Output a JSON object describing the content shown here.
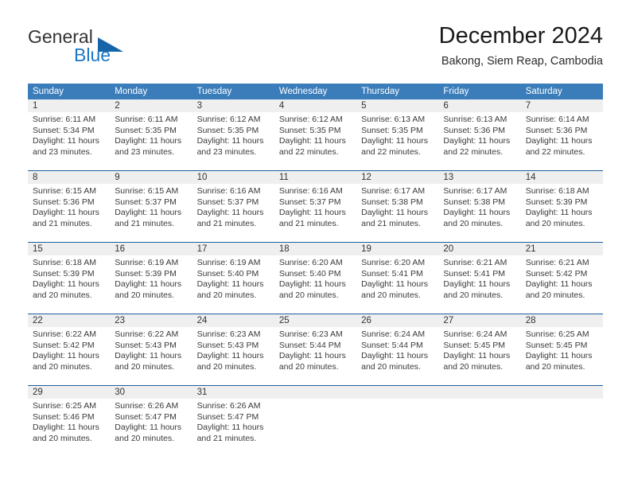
{
  "brand": {
    "line1": "General",
    "line2": "Blue",
    "icon": "triangle-logo",
    "accent_color": "#1d77c4"
  },
  "header": {
    "month_title": "December 2024",
    "location": "Bakong, Siem Reap, Cambodia"
  },
  "calendar": {
    "header_bg": "#3a7dba",
    "weekdays": [
      "Sunday",
      "Monday",
      "Tuesday",
      "Wednesday",
      "Thursday",
      "Friday",
      "Saturday"
    ],
    "weeks": [
      [
        {
          "day": "1",
          "sunrise": "Sunrise: 6:11 AM",
          "sunset": "Sunset: 5:34 PM",
          "daylight_1": "Daylight: 11 hours",
          "daylight_2": "and 23 minutes."
        },
        {
          "day": "2",
          "sunrise": "Sunrise: 6:11 AM",
          "sunset": "Sunset: 5:35 PM",
          "daylight_1": "Daylight: 11 hours",
          "daylight_2": "and 23 minutes."
        },
        {
          "day": "3",
          "sunrise": "Sunrise: 6:12 AM",
          "sunset": "Sunset: 5:35 PM",
          "daylight_1": "Daylight: 11 hours",
          "daylight_2": "and 23 minutes."
        },
        {
          "day": "4",
          "sunrise": "Sunrise: 6:12 AM",
          "sunset": "Sunset: 5:35 PM",
          "daylight_1": "Daylight: 11 hours",
          "daylight_2": "and 22 minutes."
        },
        {
          "day": "5",
          "sunrise": "Sunrise: 6:13 AM",
          "sunset": "Sunset: 5:35 PM",
          "daylight_1": "Daylight: 11 hours",
          "daylight_2": "and 22 minutes."
        },
        {
          "day": "6",
          "sunrise": "Sunrise: 6:13 AM",
          "sunset": "Sunset: 5:36 PM",
          "daylight_1": "Daylight: 11 hours",
          "daylight_2": "and 22 minutes."
        },
        {
          "day": "7",
          "sunrise": "Sunrise: 6:14 AM",
          "sunset": "Sunset: 5:36 PM",
          "daylight_1": "Daylight: 11 hours",
          "daylight_2": "and 22 minutes."
        }
      ],
      [
        {
          "day": "8",
          "sunrise": "Sunrise: 6:15 AM",
          "sunset": "Sunset: 5:36 PM",
          "daylight_1": "Daylight: 11 hours",
          "daylight_2": "and 21 minutes."
        },
        {
          "day": "9",
          "sunrise": "Sunrise: 6:15 AM",
          "sunset": "Sunset: 5:37 PM",
          "daylight_1": "Daylight: 11 hours",
          "daylight_2": "and 21 minutes."
        },
        {
          "day": "10",
          "sunrise": "Sunrise: 6:16 AM",
          "sunset": "Sunset: 5:37 PM",
          "daylight_1": "Daylight: 11 hours",
          "daylight_2": "and 21 minutes."
        },
        {
          "day": "11",
          "sunrise": "Sunrise: 6:16 AM",
          "sunset": "Sunset: 5:37 PM",
          "daylight_1": "Daylight: 11 hours",
          "daylight_2": "and 21 minutes."
        },
        {
          "day": "12",
          "sunrise": "Sunrise: 6:17 AM",
          "sunset": "Sunset: 5:38 PM",
          "daylight_1": "Daylight: 11 hours",
          "daylight_2": "and 21 minutes."
        },
        {
          "day": "13",
          "sunrise": "Sunrise: 6:17 AM",
          "sunset": "Sunset: 5:38 PM",
          "daylight_1": "Daylight: 11 hours",
          "daylight_2": "and 20 minutes."
        },
        {
          "day": "14",
          "sunrise": "Sunrise: 6:18 AM",
          "sunset": "Sunset: 5:39 PM",
          "daylight_1": "Daylight: 11 hours",
          "daylight_2": "and 20 minutes."
        }
      ],
      [
        {
          "day": "15",
          "sunrise": "Sunrise: 6:18 AM",
          "sunset": "Sunset: 5:39 PM",
          "daylight_1": "Daylight: 11 hours",
          "daylight_2": "and 20 minutes."
        },
        {
          "day": "16",
          "sunrise": "Sunrise: 6:19 AM",
          "sunset": "Sunset: 5:39 PM",
          "daylight_1": "Daylight: 11 hours",
          "daylight_2": "and 20 minutes."
        },
        {
          "day": "17",
          "sunrise": "Sunrise: 6:19 AM",
          "sunset": "Sunset: 5:40 PM",
          "daylight_1": "Daylight: 11 hours",
          "daylight_2": "and 20 minutes."
        },
        {
          "day": "18",
          "sunrise": "Sunrise: 6:20 AM",
          "sunset": "Sunset: 5:40 PM",
          "daylight_1": "Daylight: 11 hours",
          "daylight_2": "and 20 minutes."
        },
        {
          "day": "19",
          "sunrise": "Sunrise: 6:20 AM",
          "sunset": "Sunset: 5:41 PM",
          "daylight_1": "Daylight: 11 hours",
          "daylight_2": "and 20 minutes."
        },
        {
          "day": "20",
          "sunrise": "Sunrise: 6:21 AM",
          "sunset": "Sunset: 5:41 PM",
          "daylight_1": "Daylight: 11 hours",
          "daylight_2": "and 20 minutes."
        },
        {
          "day": "21",
          "sunrise": "Sunrise: 6:21 AM",
          "sunset": "Sunset: 5:42 PM",
          "daylight_1": "Daylight: 11 hours",
          "daylight_2": "and 20 minutes."
        }
      ],
      [
        {
          "day": "22",
          "sunrise": "Sunrise: 6:22 AM",
          "sunset": "Sunset: 5:42 PM",
          "daylight_1": "Daylight: 11 hours",
          "daylight_2": "and 20 minutes."
        },
        {
          "day": "23",
          "sunrise": "Sunrise: 6:22 AM",
          "sunset": "Sunset: 5:43 PM",
          "daylight_1": "Daylight: 11 hours",
          "daylight_2": "and 20 minutes."
        },
        {
          "day": "24",
          "sunrise": "Sunrise: 6:23 AM",
          "sunset": "Sunset: 5:43 PM",
          "daylight_1": "Daylight: 11 hours",
          "daylight_2": "and 20 minutes."
        },
        {
          "day": "25",
          "sunrise": "Sunrise: 6:23 AM",
          "sunset": "Sunset: 5:44 PM",
          "daylight_1": "Daylight: 11 hours",
          "daylight_2": "and 20 minutes."
        },
        {
          "day": "26",
          "sunrise": "Sunrise: 6:24 AM",
          "sunset": "Sunset: 5:44 PM",
          "daylight_1": "Daylight: 11 hours",
          "daylight_2": "and 20 minutes."
        },
        {
          "day": "27",
          "sunrise": "Sunrise: 6:24 AM",
          "sunset": "Sunset: 5:45 PM",
          "daylight_1": "Daylight: 11 hours",
          "daylight_2": "and 20 minutes."
        },
        {
          "day": "28",
          "sunrise": "Sunrise: 6:25 AM",
          "sunset": "Sunset: 5:45 PM",
          "daylight_1": "Daylight: 11 hours",
          "daylight_2": "and 20 minutes."
        }
      ],
      [
        {
          "day": "29",
          "sunrise": "Sunrise: 6:25 AM",
          "sunset": "Sunset: 5:46 PM",
          "daylight_1": "Daylight: 11 hours",
          "daylight_2": "and 20 minutes."
        },
        {
          "day": "30",
          "sunrise": "Sunrise: 6:26 AM",
          "sunset": "Sunset: 5:47 PM",
          "daylight_1": "Daylight: 11 hours",
          "daylight_2": "and 20 minutes."
        },
        {
          "day": "31",
          "sunrise": "Sunrise: 6:26 AM",
          "sunset": "Sunset: 5:47 PM",
          "daylight_1": "Daylight: 11 hours",
          "daylight_2": "and 21 minutes."
        },
        {
          "day": "",
          "sunrise": "",
          "sunset": "",
          "daylight_1": "",
          "daylight_2": ""
        },
        {
          "day": "",
          "sunrise": "",
          "sunset": "",
          "daylight_1": "",
          "daylight_2": ""
        },
        {
          "day": "",
          "sunrise": "",
          "sunset": "",
          "daylight_1": "",
          "daylight_2": ""
        },
        {
          "day": "",
          "sunrise": "",
          "sunset": "",
          "daylight_1": "",
          "daylight_2": ""
        }
      ]
    ]
  }
}
